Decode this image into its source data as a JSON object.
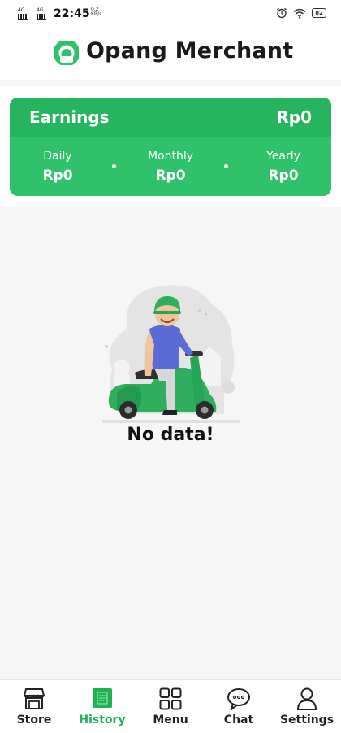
{
  "status_bar": {
    "sim1": "4G",
    "sim2": "4G",
    "time": "22:45",
    "speed_value": "0.2",
    "speed_unit": "KB/s",
    "battery": "82"
  },
  "header": {
    "title": "Opang Merchant"
  },
  "earnings": {
    "title": "Earnings",
    "total": "Rp0",
    "periods": [
      {
        "label": "Daily",
        "value": "Rp0"
      },
      {
        "label": "Monthly",
        "value": "Rp0"
      },
      {
        "label": "Yearly",
        "value": "Rp0"
      }
    ]
  },
  "empty_state": {
    "message": "No data!"
  },
  "nav": {
    "items": [
      {
        "label": "Store",
        "icon": "store-icon"
      },
      {
        "label": "History",
        "icon": "history-icon"
      },
      {
        "label": "Menu",
        "icon": "menu-grid-icon"
      },
      {
        "label": "Chat",
        "icon": "chat-icon"
      },
      {
        "label": "Settings",
        "icon": "user-icon"
      }
    ],
    "active": "History"
  },
  "colors": {
    "brand_green": "#2fc26b",
    "brand_green_dark": "#26b45f",
    "active_nav": "#20b155"
  }
}
